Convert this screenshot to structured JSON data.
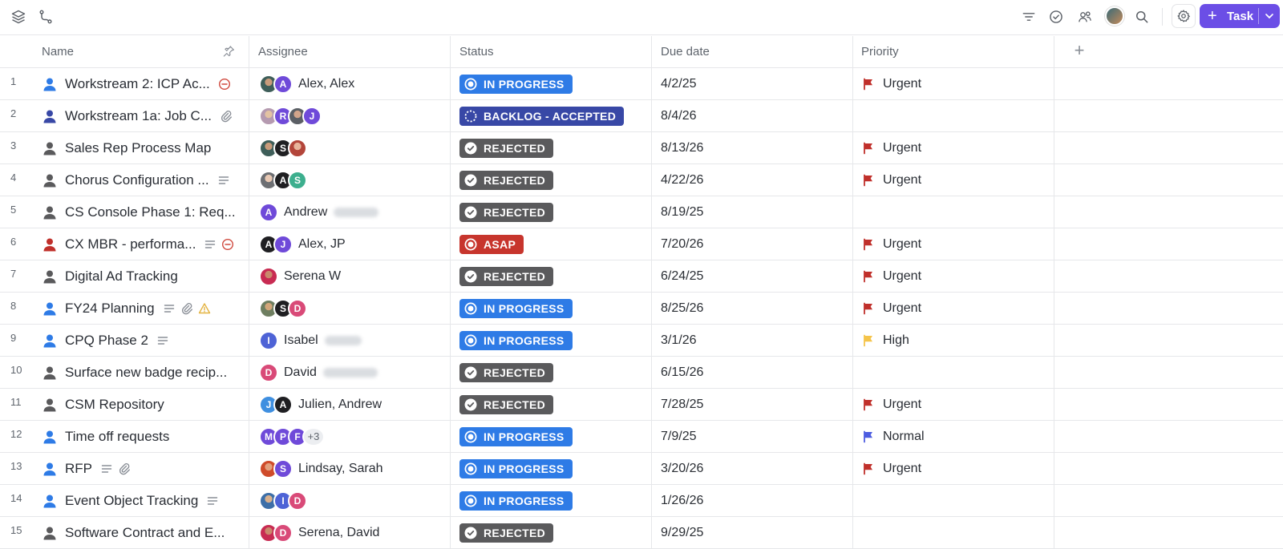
{
  "toolbar": {
    "task_button_label": "Task",
    "left_icons": [
      "layers-icon",
      "route-icon"
    ],
    "right_icons": [
      "filter-icon",
      "check-circle-icon",
      "people-icon",
      "avatar",
      "search-icon",
      "gear-icon"
    ]
  },
  "columns": {
    "name": "Name",
    "assignee": "Assignee",
    "status": "Status",
    "due": "Due date",
    "priority": "Priority",
    "add": "+"
  },
  "colors": {
    "in_progress": "#2e7be6",
    "backlog_accepted": "#3848a6",
    "rejected": "#5a5a5c",
    "asap": "#c7352d",
    "urgent": "#c0302b",
    "high": "#f5c44a",
    "normal": "#4c5ce0",
    "accent": "#6b4ee6"
  },
  "rows": [
    {
      "num": "1",
      "name": "Workstream 2: ICP Ac...",
      "person_color": "#2e7be6",
      "icons": [
        "blocked-icon"
      ],
      "avatars": [
        {
          "kind": "photo1"
        },
        {
          "letter": "A",
          "color": "#6f4ad9"
        }
      ],
      "assignee": "Alex, Alex",
      "blur": 0,
      "status": "IN PROGRESS",
      "status_key": "in_progress",
      "due": "4/2/25",
      "priority": "Urgent",
      "priority_key": "urgent"
    },
    {
      "num": "2",
      "name": "Workstream 1a: Job C...",
      "person_color": "#3848a6",
      "icons": [
        "attachment-icon"
      ],
      "avatars": [
        {
          "kind": "photo2"
        },
        {
          "letter": "R",
          "color": "#6f4ad9"
        },
        {
          "kind": "photo3"
        },
        {
          "letter": "J",
          "color": "#6f4ad9"
        }
      ],
      "assignee": "",
      "blur": 0,
      "status": "BACKLOG - ACCEPTED",
      "status_key": "backlog_accepted",
      "due": "8/4/26",
      "priority": "",
      "priority_key": ""
    },
    {
      "num": "3",
      "name": "Sales Rep Process Map",
      "person_color": "#5a5a5c",
      "icons": [],
      "avatars": [
        {
          "kind": "photo1"
        },
        {
          "letter": "S",
          "color": "#1f1f22"
        },
        {
          "kind": "photo4"
        }
      ],
      "assignee": "",
      "blur": 0,
      "status": "REJECTED",
      "status_key": "rejected",
      "due": "8/13/26",
      "priority": "Urgent",
      "priority_key": "urgent"
    },
    {
      "num": "4",
      "name": "Chorus Configuration ...",
      "person_color": "#5a5a5c",
      "icons": [
        "description-icon"
      ],
      "avatars": [
        {
          "kind": "photo5"
        },
        {
          "letter": "A",
          "color": "#1f1f22"
        },
        {
          "letter": "S",
          "color": "#3daf8e"
        }
      ],
      "assignee": "",
      "blur": 0,
      "status": "REJECTED",
      "status_key": "rejected",
      "due": "4/22/26",
      "priority": "Urgent",
      "priority_key": "urgent"
    },
    {
      "num": "5",
      "name": "CS Console Phase 1: Req...",
      "person_color": "#5a5a5c",
      "icons": [],
      "avatars": [
        {
          "letter": "A",
          "color": "#6f4ad9"
        }
      ],
      "assignee": "Andrew",
      "blur": 56,
      "status": "REJECTED",
      "status_key": "rejected",
      "due": "8/19/25",
      "priority": "",
      "priority_key": ""
    },
    {
      "num": "6",
      "name": "CX MBR - performa...",
      "person_color": "#c0302b",
      "icons": [
        "description-icon",
        "blocked-icon"
      ],
      "avatars": [
        {
          "letter": "A",
          "color": "#1f1f22"
        },
        {
          "letter": "J",
          "color": "#6f4ad9"
        }
      ],
      "assignee": "Alex, JP",
      "blur": 0,
      "status": "ASAP",
      "status_key": "asap",
      "due": "7/20/26",
      "priority": "Urgent",
      "priority_key": "urgent"
    },
    {
      "num": "7",
      "name": "Digital Ad Tracking",
      "person_color": "#5a5a5c",
      "icons": [],
      "avatars": [
        {
          "kind": "photo6"
        }
      ],
      "assignee": "Serena W",
      "blur": 0,
      "status": "REJECTED",
      "status_key": "rejected",
      "due": "6/24/25",
      "priority": "Urgent",
      "priority_key": "urgent"
    },
    {
      "num": "8",
      "name": "FY24 Planning",
      "person_color": "#2e7be6",
      "icons": [
        "description-icon",
        "attachment-icon",
        "warning-icon"
      ],
      "avatars": [
        {
          "kind": "photo7"
        },
        {
          "letter": "S",
          "color": "#1f1f22"
        },
        {
          "letter": "D",
          "color": "#d94a78"
        }
      ],
      "assignee": "",
      "blur": 0,
      "status": "IN PROGRESS",
      "status_key": "in_progress",
      "due": "8/25/26",
      "priority": "Urgent",
      "priority_key": "urgent"
    },
    {
      "num": "9",
      "name": "CPQ Phase 2",
      "person_color": "#2e7be6",
      "icons": [
        "description-icon"
      ],
      "avatars": [
        {
          "letter": "I",
          "color": "#4e63d6"
        }
      ],
      "assignee": "Isabel",
      "blur": 46,
      "status": "IN PROGRESS",
      "status_key": "in_progress",
      "due": "3/1/26",
      "priority": "High",
      "priority_key": "high"
    },
    {
      "num": "10",
      "name": "Surface new badge recip...",
      "person_color": "#5a5a5c",
      "icons": [],
      "avatars": [
        {
          "letter": "D",
          "color": "#d94a78"
        }
      ],
      "assignee": "David",
      "blur": 68,
      "status": "REJECTED",
      "status_key": "rejected",
      "due": "6/15/26",
      "priority": "",
      "priority_key": ""
    },
    {
      "num": "11",
      "name": "CSM Repository",
      "person_color": "#5a5a5c",
      "icons": [],
      "avatars": [
        {
          "letter": "J",
          "color": "#3f8fe0"
        },
        {
          "letter": "A",
          "color": "#1f1f22"
        }
      ],
      "assignee": "Julien, Andrew",
      "blur": 0,
      "status": "REJECTED",
      "status_key": "rejected",
      "due": "7/28/25",
      "priority": "Urgent",
      "priority_key": "urgent"
    },
    {
      "num": "12",
      "name": "Time off requests",
      "person_color": "#2e7be6",
      "icons": [],
      "avatars": [
        {
          "letter": "M",
          "color": "#6f4ad9"
        },
        {
          "letter": "P",
          "color": "#6f4ad9"
        },
        {
          "letter": "F",
          "color": "#6f4ad9"
        }
      ],
      "more": "+3",
      "assignee": "",
      "blur": 0,
      "status": "IN PROGRESS",
      "status_key": "in_progress",
      "due": "7/9/25",
      "priority": "Normal",
      "priority_key": "normal"
    },
    {
      "num": "13",
      "name": "RFP",
      "person_color": "#2e7be6",
      "icons": [
        "description-icon",
        "attachment-icon"
      ],
      "avatars": [
        {
          "kind": "photo8"
        },
        {
          "letter": "S",
          "color": "#6f4ad9"
        }
      ],
      "assignee": "Lindsay, Sarah",
      "blur": 0,
      "status": "IN PROGRESS",
      "status_key": "in_progress",
      "due": "3/20/26",
      "priority": "Urgent",
      "priority_key": "urgent"
    },
    {
      "num": "14",
      "name": "Event Object Tracking",
      "person_color": "#2e7be6",
      "icons": [
        "description-icon"
      ],
      "avatars": [
        {
          "kind": "photo9"
        },
        {
          "letter": "I",
          "color": "#4e63d6"
        },
        {
          "letter": "D",
          "color": "#d94a78"
        }
      ],
      "assignee": "",
      "blur": 0,
      "status": "IN PROGRESS",
      "status_key": "in_progress",
      "due": "1/26/26",
      "priority": "",
      "priority_key": ""
    },
    {
      "num": "15",
      "name": "Software Contract and E...",
      "person_color": "#5a5a5c",
      "icons": [],
      "avatars": [
        {
          "kind": "photo6"
        },
        {
          "letter": "D",
          "color": "#d94a78"
        }
      ],
      "assignee": "Serena, David",
      "blur": 0,
      "status": "REJECTED",
      "status_key": "rejected",
      "due": "9/29/25",
      "priority": "",
      "priority_key": ""
    }
  ]
}
